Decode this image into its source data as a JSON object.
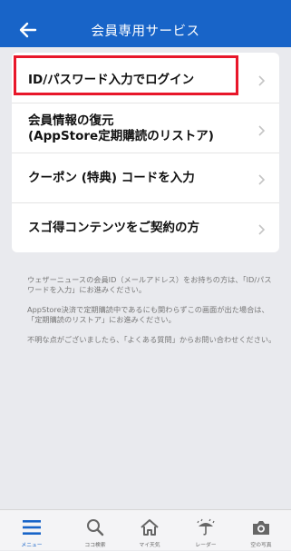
{
  "header": {
    "title": "会員専用サービス",
    "back_icon": "back-arrow-icon"
  },
  "menu": {
    "items": [
      {
        "label": "ID/パスワード入力でログイン"
      },
      {
        "label_line1": "会員情報の復元",
        "label_line2": "(AppStore定期購読のリストア)"
      },
      {
        "label": "クーポン (特典) コードを入力"
      },
      {
        "label": "スゴ得コンテンツをご契約の方"
      }
    ]
  },
  "notes": {
    "p1": "ウェザーニュースの会員ID（メールアドレス）をお持ちの方は、「ID/パスワードを入力」にお進みください。",
    "p2": "AppStore決済で定期購読中であるにも関わらずこの画面が出た場合は、「定期購読のリストア」にお進みください。",
    "p3": "不明な点がございましたら、「よくある質問」からお問い合わせください。"
  },
  "tabbar": {
    "tabs": [
      {
        "label": "メニュー",
        "icon": "menu-icon",
        "active": true
      },
      {
        "label": "ココ検索",
        "icon": "search-icon"
      },
      {
        "label": "マイ天気",
        "icon": "home-icon"
      },
      {
        "label": "レーダー",
        "icon": "umbrella-rain-icon"
      },
      {
        "label": "空の写真",
        "icon": "camera-icon"
      }
    ]
  },
  "colors": {
    "header_bg": "#1864c8",
    "highlight": "#e8172a",
    "active_tab": "#1864c8"
  }
}
